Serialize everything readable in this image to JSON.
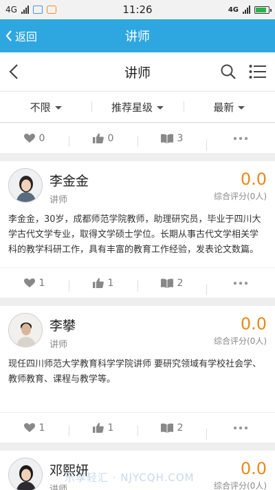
{
  "status": {
    "network": "4G",
    "time": "11:26",
    "network_right": "4G"
  },
  "app_header": {
    "back_label": "返回",
    "title": "讲师"
  },
  "page": {
    "title": "讲师"
  },
  "filters": [
    "不限",
    "推荐星级",
    "最新"
  ],
  "top_actions": {
    "favorites": "0",
    "likes": "0",
    "courses": "3"
  },
  "teachers": [
    {
      "name": "李金金",
      "role": "讲师",
      "score": "0.0",
      "score_label": "综合评分(0人)",
      "desc": "李金金，30岁，成都师范学院教师，助理研究员，毕业于四川大学古代文学专业，取得文学硕士学位。长期从事古代文学相关学科的教学科研工作，具有丰富的教育工作经验，发表论文数篇。",
      "favorites": "1",
      "likes": "1",
      "courses": "2"
    },
    {
      "name": "李攀",
      "role": "讲师",
      "score": "0.0",
      "score_label": "综合评分(0人)",
      "desc": " 现任四川师范大学教育科学学院讲师 要研究领域有学校社会学、教师教育、课程与教学等。",
      "favorites": "1",
      "likes": "1",
      "courses": "2"
    },
    {
      "name": "邓熙妍",
      "role": "讲师",
      "score": "0.0",
      "score_label": "综合评分(0人)"
    }
  ],
  "watermark": "乐享轻汇 · NJYCQH.COM",
  "colors": {
    "header": "#2ea7e0",
    "score": "#e8891c"
  }
}
